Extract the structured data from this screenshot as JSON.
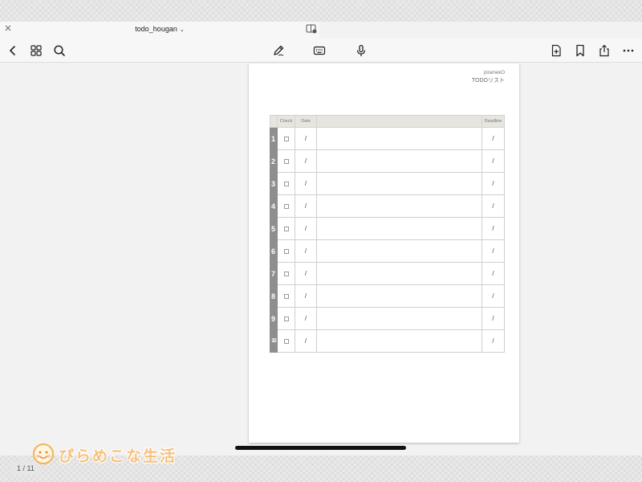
{
  "tab": {
    "title": "todo_hougan"
  },
  "icons": {
    "close": "close-icon",
    "split_view": "split-view-icon",
    "back": "chevron-left-icon",
    "grid": "grid-icon",
    "search": "search-icon",
    "pen": "pen-icon",
    "keyboard": "keyboard-icon",
    "mic": "microphone-icon",
    "add_page": "add-page-icon",
    "bookmark": "bookmark-icon",
    "share": "share-icon",
    "more": "more-icon"
  },
  "document": {
    "brand": "piramekO",
    "subtitle": "TODOリスト",
    "headers": {
      "check": "Check",
      "date": "Date",
      "task": "",
      "deadline": "Deadline"
    },
    "rows": [
      {
        "num": "1",
        "date": "/",
        "deadline": "/"
      },
      {
        "num": "2",
        "date": "/",
        "deadline": "/"
      },
      {
        "num": "3",
        "date": "/",
        "deadline": "/"
      },
      {
        "num": "4",
        "date": "/",
        "deadline": "/"
      },
      {
        "num": "5",
        "date": "/",
        "deadline": "/"
      },
      {
        "num": "6",
        "date": "/",
        "deadline": "/"
      },
      {
        "num": "7",
        "date": "/",
        "deadline": "/"
      },
      {
        "num": "8",
        "date": "/",
        "deadline": "/"
      },
      {
        "num": "9",
        "date": "/",
        "deadline": "/"
      },
      {
        "num": "10",
        "date": "/",
        "deadline": "/"
      }
    ]
  },
  "page_indicator": "1 / 11",
  "watermark": "ぴらめこな生活",
  "colors": {
    "row_number_bg": "#8e8e8e",
    "header_bg": "#e6e5e0",
    "watermark": "#f7c07a"
  }
}
